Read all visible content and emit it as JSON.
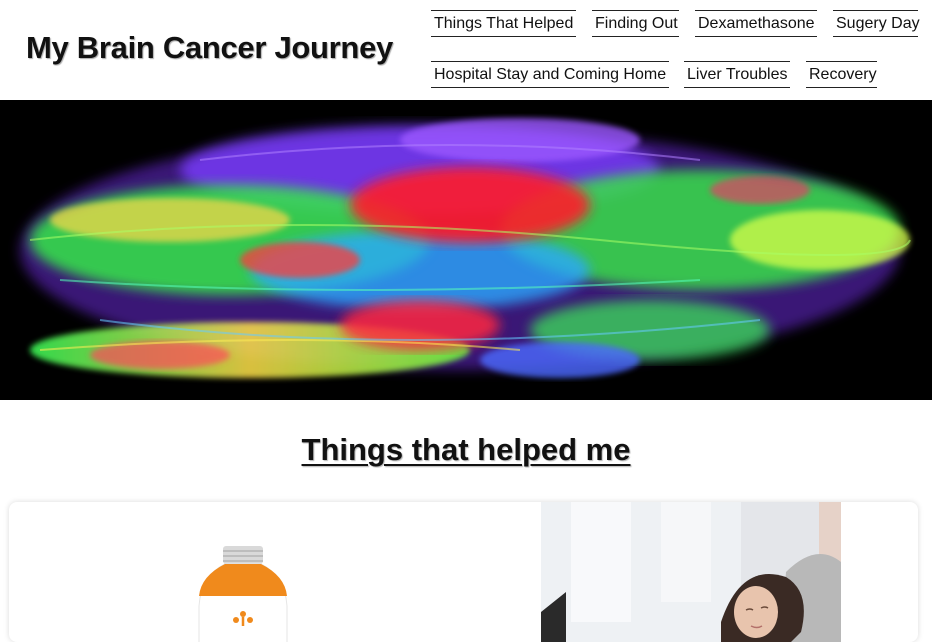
{
  "site": {
    "title": "My Brain Cancer Journey"
  },
  "nav": {
    "items": [
      {
        "label": "Things That Helped"
      },
      {
        "label": "Finding Out"
      },
      {
        "label": "Dexamethasone"
      },
      {
        "label": "Sugery Day"
      },
      {
        "label": "Hospital Stay and Coming Home"
      },
      {
        "label": "Liver Troubles"
      },
      {
        "label": "Recovery"
      }
    ]
  },
  "hero": {
    "icon": "brain-tractography-image",
    "background": "#000000"
  },
  "main": {
    "heading": "Things that helped me",
    "cards": [
      {
        "icon": "drink-bottle-image",
        "accent": "#f08a1c"
      },
      {
        "icon": "resting-woman-photo"
      }
    ]
  },
  "colors": {
    "text": "#111111",
    "background": "#ffffff"
  }
}
